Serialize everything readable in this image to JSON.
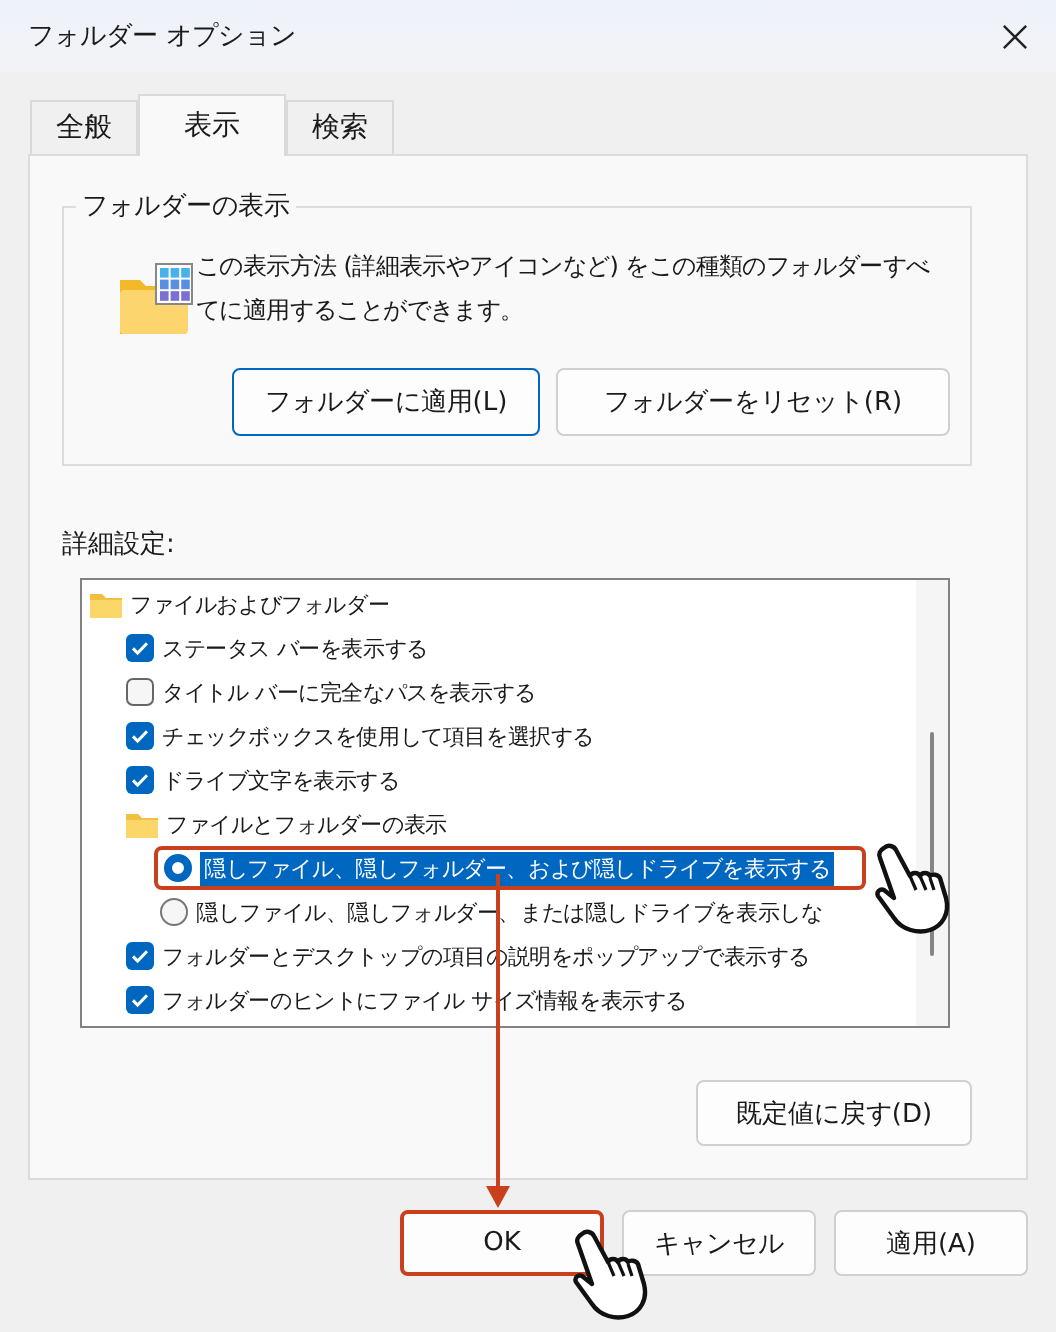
{
  "window": {
    "title": "フォルダー オプション"
  },
  "tabs": [
    {
      "label": "全般",
      "selected": false
    },
    {
      "label": "表示",
      "selected": true
    },
    {
      "label": "検索",
      "selected": false
    }
  ],
  "folder_views": {
    "title": "フォルダーの表示",
    "description": "この表示方法 (詳細表示やアイコンなど) をこの種類のフォルダーすべてに適用することができます。",
    "buttons": [
      {
        "label": "フォルダーに適用(L)",
        "focused": true
      },
      {
        "label": "フォルダーをリセット(R)",
        "focused": false
      }
    ]
  },
  "advanced": {
    "label": "詳細設定:",
    "items": [
      {
        "kind": "folder",
        "label": "ファイルおよびフォルダー",
        "children": [
          {
            "kind": "checkbox",
            "label": "ステータス バーを表示する",
            "checked": true
          },
          {
            "kind": "checkbox",
            "label": "タイトル バーに完全なパスを表示する",
            "checked": false
          },
          {
            "kind": "checkbox",
            "label": "チェックボックスを使用して項目を選択する",
            "checked": true
          },
          {
            "kind": "checkbox",
            "label": "ドライブ文字を表示する",
            "checked": true
          },
          {
            "kind": "folder",
            "label": "ファイルとフォルダーの表示",
            "children": [
              {
                "kind": "radio",
                "label": "隠しファイル、隠しフォルダー、および隠しドライブを表示する",
                "selected": true,
                "highlighted": true
              },
              {
                "kind": "radio",
                "label": "隠しファイル、隠しフォルダー、または隠しドライブを表示しな",
                "selected": false,
                "highlighted": false
              }
            ]
          },
          {
            "kind": "checkbox",
            "label": "フォルダーとデスクトップの項目の説明をポップアップで表示する",
            "checked": true
          },
          {
            "kind": "checkbox",
            "label": "フォルダーのヒントにファイル サイズ情報を表示する",
            "checked": true
          }
        ]
      }
    ],
    "restore_button": "既定値に戻す(D)"
  },
  "dialog_buttons": [
    {
      "label": "OK",
      "highlighted": true
    },
    {
      "label": "キャンセル",
      "highlighted": false
    },
    {
      "label": "適用(A)",
      "highlighted": false
    }
  ]
}
